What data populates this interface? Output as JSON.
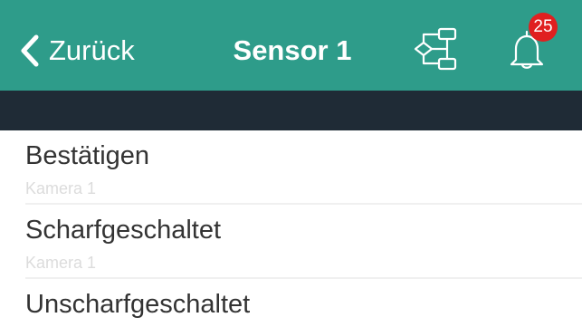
{
  "colors": {
    "navbar": "#2e9c8a",
    "subbar": "#1f2b36",
    "badge": "#e02020",
    "title_text": "#333333",
    "subtitle_text": "#dcdcdc"
  },
  "navbar": {
    "back_label": "Zurück",
    "back_icon": "chevron-left-icon",
    "title": "Sensor 1",
    "flow_icon": "flowchart-icon",
    "bell_icon": "bell-icon",
    "notification_count": "25"
  },
  "list": {
    "items": [
      {
        "title": "Bestätigen",
        "subtitle": "Kamera 1"
      },
      {
        "title": "Scharfgeschaltet",
        "subtitle": "Kamera 1"
      },
      {
        "title": "Unscharfgeschaltet"
      }
    ]
  }
}
